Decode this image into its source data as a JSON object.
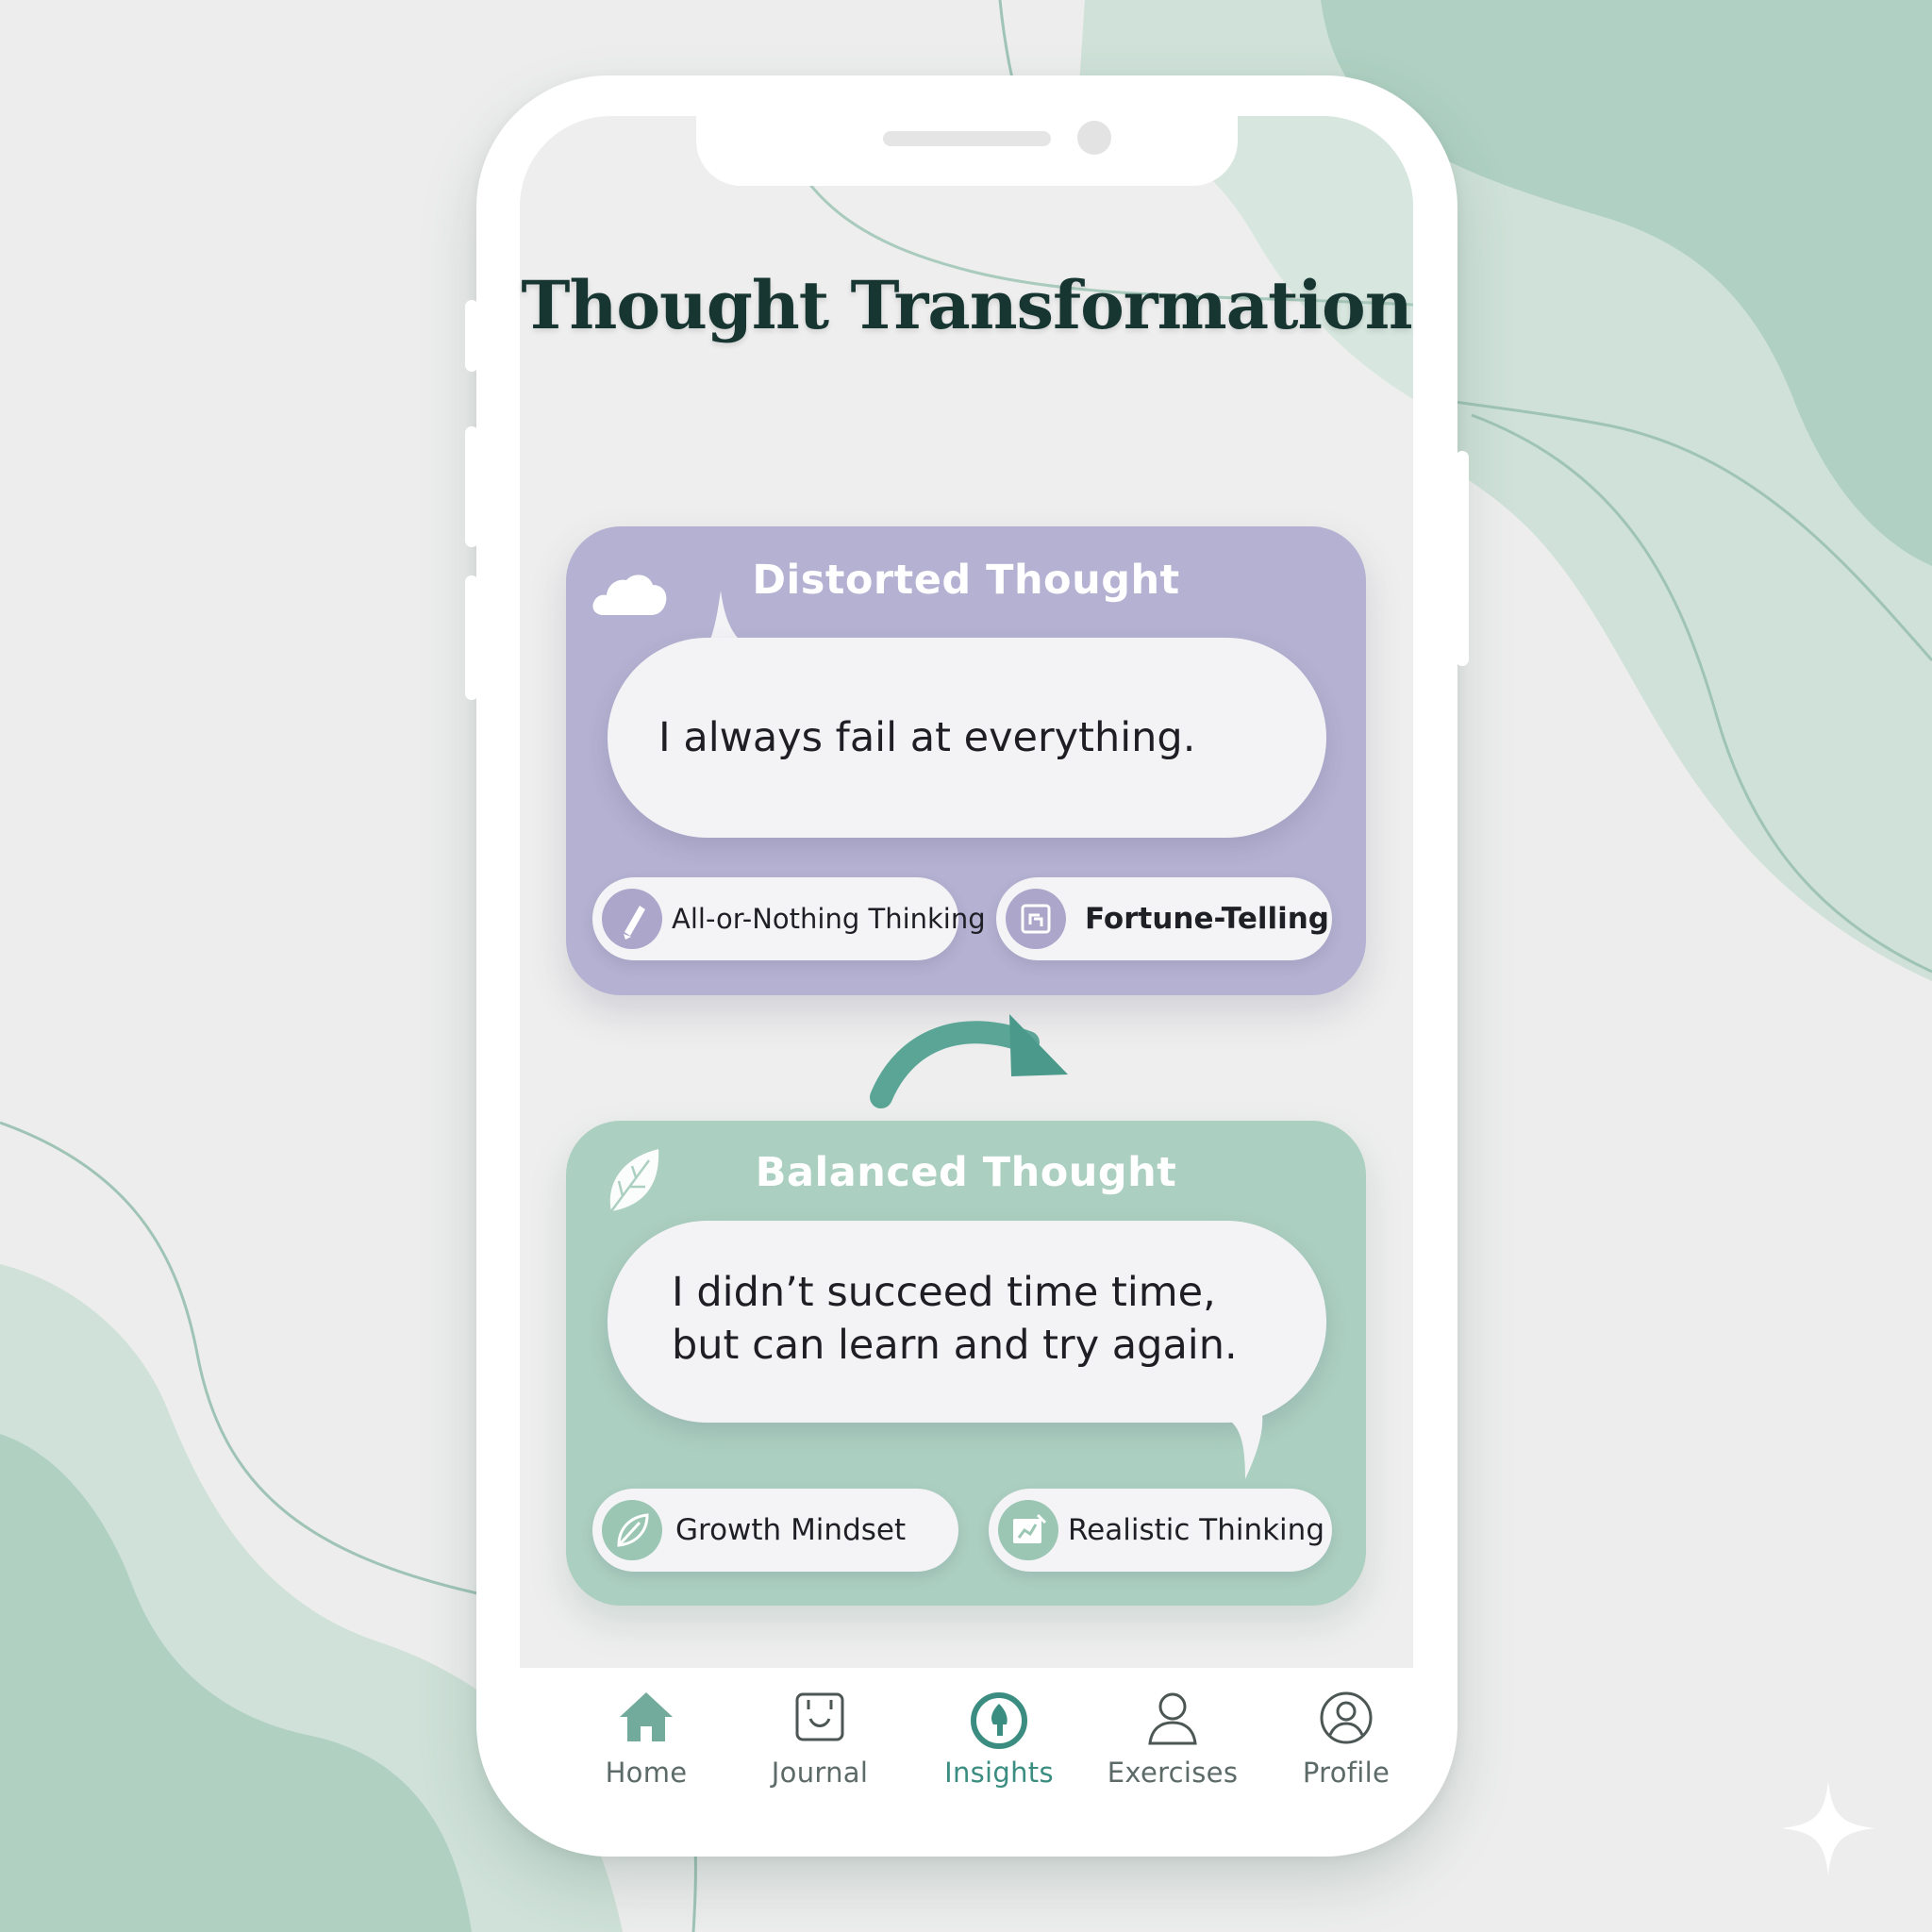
{
  "screen": {
    "title": "Thought Transformation"
  },
  "distorted": {
    "title": "Distorted Thought",
    "icon": "cloud-icon",
    "thought": "I always fail at everything.",
    "tags": [
      {
        "label": "All-or-Nothing Thinking",
        "icon": "broken-pencil-icon"
      },
      {
        "label": "Fortune-Telling",
        "icon": "crystal-frame-icon"
      }
    ]
  },
  "balanced": {
    "title": "Balanced Thought",
    "icon": "leaf-icon",
    "thought_line1": "I didn’t succeed time time,",
    "thought_line2": "but can learn and try again.",
    "tags": [
      {
        "label": "Growth Mindset",
        "icon": "leaf-icon"
      },
      {
        "label": "Realistic Thinking",
        "icon": "chart-icon"
      }
    ]
  },
  "transition": {
    "icon": "curved-arrow-icon"
  },
  "nav": {
    "items": [
      {
        "label": "Home",
        "icon": "home-icon",
        "active": false
      },
      {
        "label": "Journal",
        "icon": "journal-icon",
        "active": false
      },
      {
        "label": "Insights",
        "icon": "insights-icon",
        "active": true
      },
      {
        "label": "Exercises",
        "icon": "person-icon",
        "active": false
      },
      {
        "label": "Profile",
        "icon": "profile-icon",
        "active": false
      }
    ]
  },
  "colors": {
    "background": "#ededed",
    "mint": "#abcfc0",
    "lavender": "#b5b1d2",
    "teal_accent": "#3a8d80",
    "title": "#173632"
  }
}
